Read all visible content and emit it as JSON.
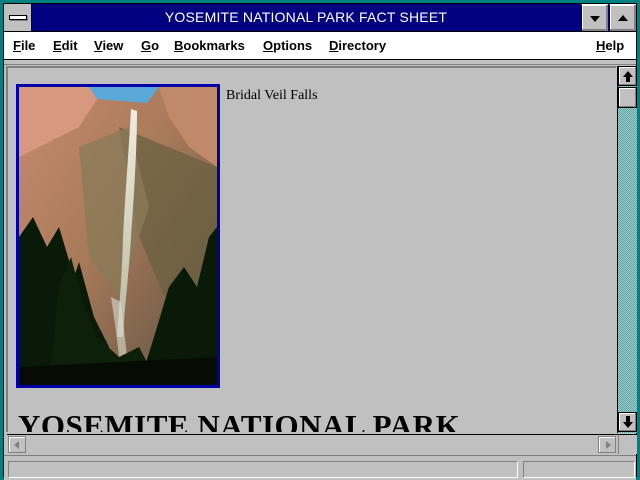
{
  "window": {
    "title": "YOSEMITE NATIONAL PARK FACT SHEET"
  },
  "menubar": {
    "items": [
      {
        "underline": "F",
        "rest": "ile"
      },
      {
        "underline": "E",
        "rest": "dit"
      },
      {
        "underline": "V",
        "rest": "iew"
      },
      {
        "underline": "G",
        "rest": "o"
      },
      {
        "underline": "B",
        "rest": "ookmarks"
      },
      {
        "underline": "O",
        "rest": "ptions"
      },
      {
        "underline": "D",
        "rest": "irectory"
      },
      {
        "underline": "H",
        "rest": "elp"
      }
    ]
  },
  "content": {
    "image_caption": "Bridal Veil Falls",
    "heading": "YOSEMITE NATIONAL PARK"
  },
  "statusbar": {
    "text": ""
  },
  "colors": {
    "titlebar": "#000080",
    "window_border": "#008080",
    "image_frame": "#0000a8",
    "background": "#c0c0c0"
  },
  "icons": {
    "system_menu": "system-menu-icon",
    "minimize": "triangle-down-icon",
    "maximize": "triangle-up-icon",
    "scroll_up": "arrow-up-icon",
    "scroll_down": "arrow-down-icon",
    "scroll_left": "arrow-left-icon",
    "scroll_right": "arrow-right-icon"
  }
}
